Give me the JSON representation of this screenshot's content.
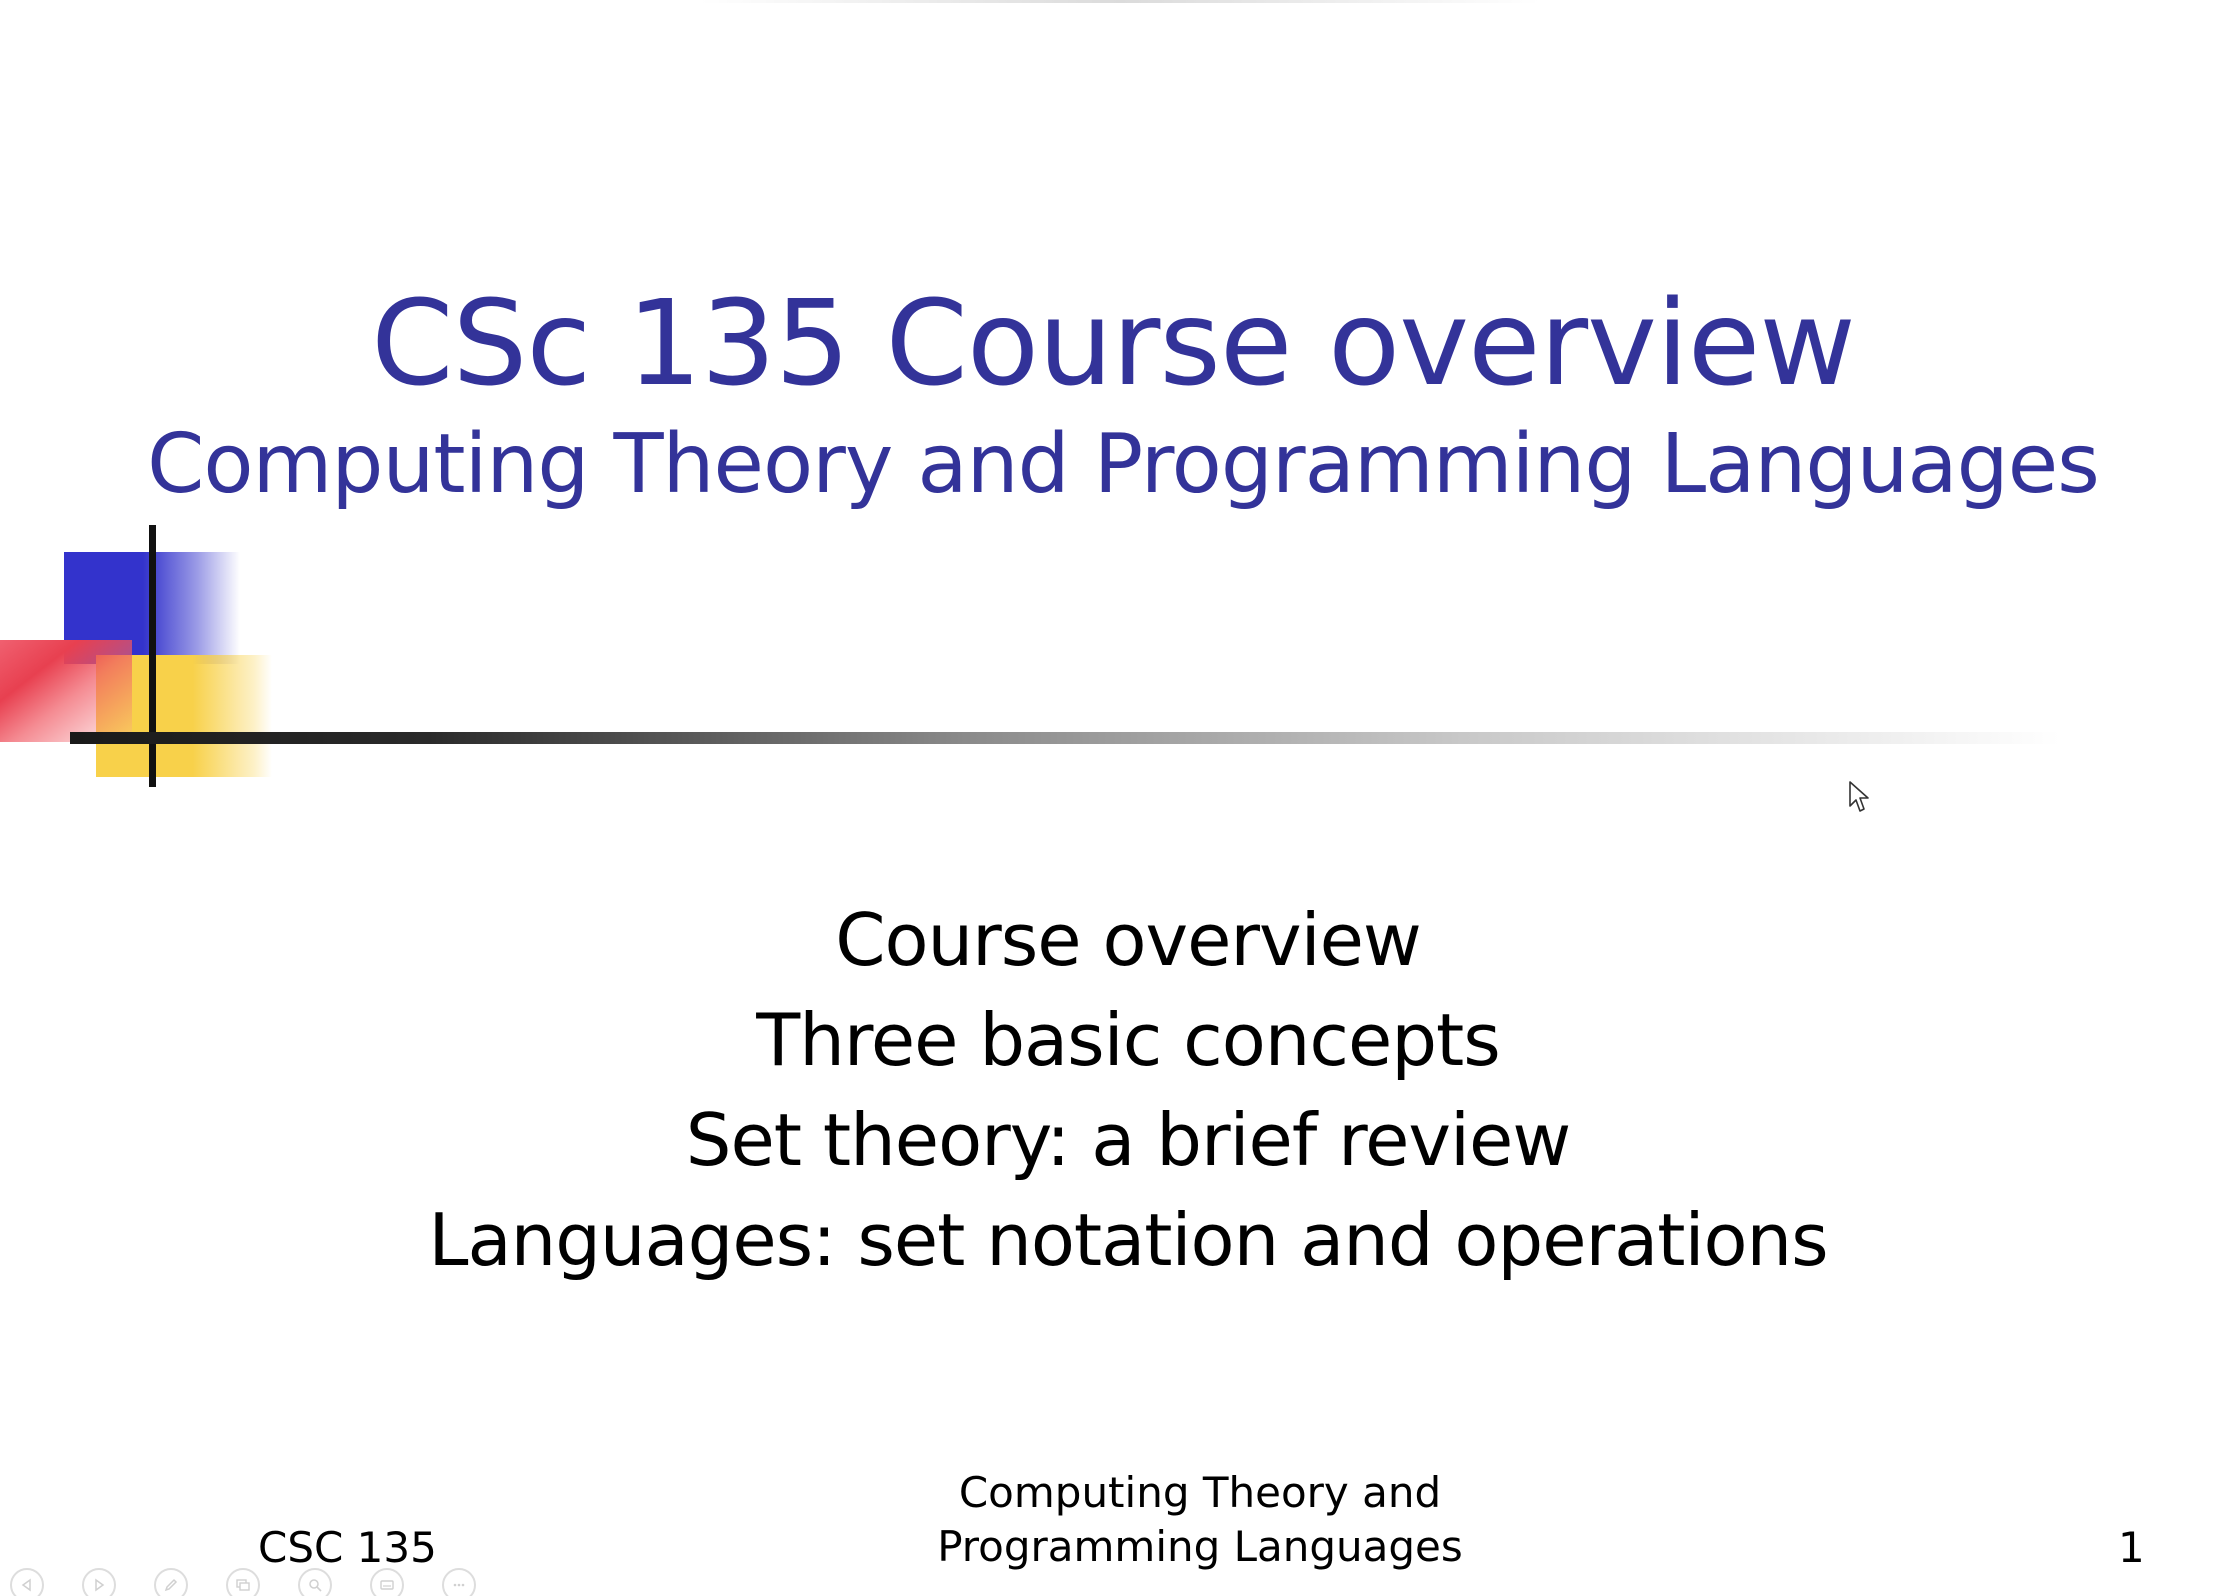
{
  "slide": {
    "title": "CSc 135 Course overview",
    "subtitle": "Computing Theory and Programming Languages",
    "topics": [
      "Course overview",
      "Three basic concepts",
      "Set theory: a brief review",
      "Languages: set notation and operations"
    ],
    "footer": {
      "left": "CSC 135",
      "center_line1": "Computing Theory and",
      "center_line2": "Programming Languages",
      "page_number": "1"
    },
    "colors": {
      "title": "#333399",
      "deco_blue": "#3333cc",
      "deco_yellow": "#f8d14a",
      "deco_red": "#e84050"
    }
  },
  "controls": {
    "icons": [
      "previous-slide-icon",
      "next-slide-icon",
      "pen-icon",
      "slides-view-icon",
      "zoom-icon",
      "subtitles-icon",
      "more-options-icon"
    ]
  }
}
